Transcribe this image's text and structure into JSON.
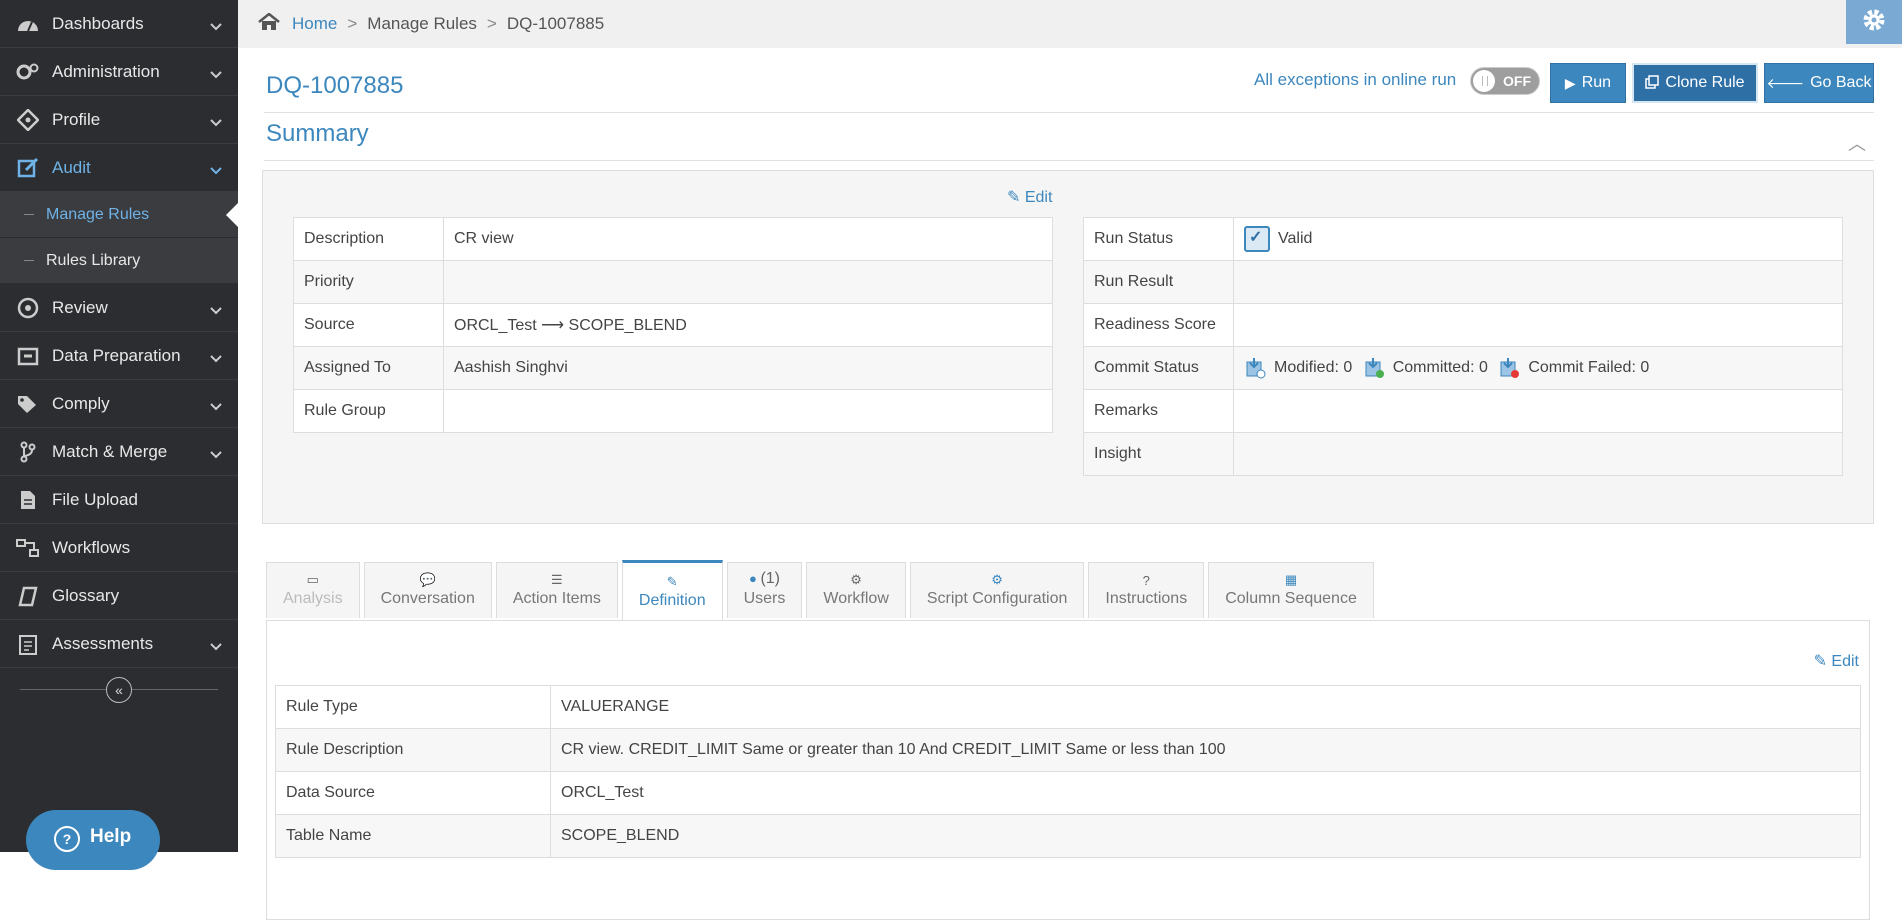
{
  "sidebar": {
    "items": [
      {
        "label": "Dashboards",
        "icon": "dashboard-icon"
      },
      {
        "label": "Administration",
        "icon": "gears-icon"
      },
      {
        "label": "Profile",
        "icon": "crosshair-icon"
      },
      {
        "label": "Audit",
        "icon": "edit-icon"
      },
      {
        "label": "Review",
        "icon": "compass-icon"
      },
      {
        "label": "Data Preparation",
        "icon": "wrench-icon"
      },
      {
        "label": "Comply",
        "icon": "tags-icon"
      },
      {
        "label": "Match & Merge",
        "icon": "branch-icon"
      },
      {
        "label": "File Upload",
        "icon": "file-icon"
      },
      {
        "label": "Workflows",
        "icon": "workflow-icon"
      },
      {
        "label": "Glossary",
        "icon": "book-icon"
      },
      {
        "label": "Assessments",
        "icon": "clipboard-icon"
      }
    ],
    "audit_sub": [
      "Manage Rules",
      "Rules Library"
    ],
    "help_label": "Help"
  },
  "breadcrumb": {
    "home": "Home",
    "section": "Manage Rules",
    "current": "DQ-1007885"
  },
  "header": {
    "rule_id": "DQ-1007885",
    "online_label": "All exceptions in online run",
    "toggle_label": "OFF",
    "run_label": "Run",
    "clone_label": "Clone Rule",
    "back_label": "Go Back"
  },
  "summary": {
    "title": "Summary",
    "edit_label": "Edit",
    "left": [
      {
        "k": "Description",
        "v": "CR view"
      },
      {
        "k": "Priority",
        "v": ""
      },
      {
        "k": "Source",
        "v": "ORCL_Test ⟶ SCOPE_BLEND"
      },
      {
        "k": "Assigned To",
        "v": "Aashish Singhvi"
      },
      {
        "k": "Rule Group",
        "v": ""
      }
    ],
    "right": {
      "run_status_k": "Run Status",
      "run_status_v": "Valid",
      "run_result_k": "Run Result",
      "readiness_k": "Readiness Score",
      "commit_k": "Commit Status",
      "modified": "Modified: 0",
      "committed": "Committed: 0",
      "commit_failed": "Commit Failed: 0",
      "remarks_k": "Remarks",
      "insight_k": "Insight"
    }
  },
  "tabs": [
    {
      "label": "Analysis",
      "icon": "cast-icon"
    },
    {
      "label": "Conversation",
      "icon": "comments-icon"
    },
    {
      "label": "Action Items",
      "icon": "list-icon"
    },
    {
      "label": "Definition",
      "icon": "edit-icon"
    },
    {
      "label": "Users",
      "badge": "(1)",
      "icon": "user-icon"
    },
    {
      "label": "Workflow",
      "icon": "cogs-icon"
    },
    {
      "label": "Script Configuration",
      "icon": "cog-icon"
    },
    {
      "label": "Instructions",
      "icon": "question-icon"
    },
    {
      "label": "Column Sequence",
      "icon": "columns-icon"
    }
  ],
  "definition": {
    "edit_label": "Edit",
    "rows": [
      {
        "k": "Rule Type",
        "v": "VALUERANGE"
      },
      {
        "k": "Rule Description",
        "v": "CR view. CREDIT_LIMIT Same or greater than 10 And CREDIT_LIMIT Same or less than 100"
      },
      {
        "k": "Data Source",
        "v": "ORCL_Test"
      },
      {
        "k": "Table Name",
        "v": "SCOPE_BLEND"
      }
    ]
  },
  "colors": {
    "accent": "#3c87bd",
    "sidebar": "#2b2d30",
    "arrow": "#3ee62a"
  }
}
